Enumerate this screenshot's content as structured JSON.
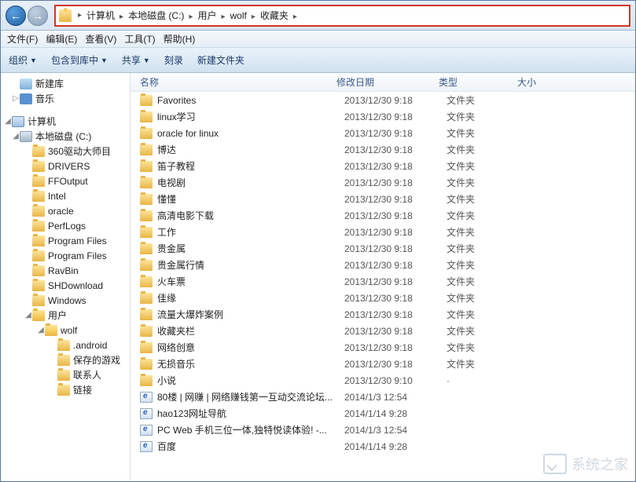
{
  "breadcrumb": [
    "计算机",
    "本地磁盘 (C:)",
    "用户",
    "wolf",
    "收藏夹"
  ],
  "menu": {
    "file": "文件(F)",
    "edit": "编辑(E)",
    "view": "查看(V)",
    "tools": "工具(T)",
    "help": "帮助(H)"
  },
  "toolbar": {
    "organize": "组织",
    "include": "包含到库中",
    "share": "共享",
    "burn": "刻录",
    "newfolder": "新建文件夹"
  },
  "columns": {
    "name": "名称",
    "date": "修改日期",
    "type": "类型",
    "size": "大小"
  },
  "tree": [
    {
      "label": "新建库",
      "indent": 1,
      "icon": "lib",
      "exp": ""
    },
    {
      "label": "音乐",
      "indent": 1,
      "icon": "music",
      "exp": "▷"
    },
    {
      "label": "",
      "indent": 0,
      "icon": "",
      "exp": ""
    },
    {
      "label": "计算机",
      "indent": 0,
      "icon": "computer",
      "exp": "◢"
    },
    {
      "label": "本地磁盘 (C:)",
      "indent": 1,
      "icon": "disk",
      "exp": "◢"
    },
    {
      "label": "360驱动大师目",
      "indent": 2,
      "icon": "folder",
      "exp": ""
    },
    {
      "label": "DRIVERS",
      "indent": 2,
      "icon": "folder",
      "exp": ""
    },
    {
      "label": "FFOutput",
      "indent": 2,
      "icon": "folder",
      "exp": ""
    },
    {
      "label": "Intel",
      "indent": 2,
      "icon": "folder",
      "exp": ""
    },
    {
      "label": "oracle",
      "indent": 2,
      "icon": "folder",
      "exp": ""
    },
    {
      "label": "PerfLogs",
      "indent": 2,
      "icon": "folder",
      "exp": ""
    },
    {
      "label": "Program Files",
      "indent": 2,
      "icon": "folder",
      "exp": ""
    },
    {
      "label": "Program Files",
      "indent": 2,
      "icon": "folder",
      "exp": ""
    },
    {
      "label": "RavBin",
      "indent": 2,
      "icon": "folder",
      "exp": ""
    },
    {
      "label": "SHDownload",
      "indent": 2,
      "icon": "folder",
      "exp": ""
    },
    {
      "label": "Windows",
      "indent": 2,
      "icon": "folder",
      "exp": ""
    },
    {
      "label": "用户",
      "indent": 2,
      "icon": "folder-open",
      "exp": "◢"
    },
    {
      "label": "wolf",
      "indent": 3,
      "icon": "folder-open",
      "exp": "◢"
    },
    {
      "label": ".android",
      "indent": 4,
      "icon": "folder",
      "exp": ""
    },
    {
      "label": "保存的游戏",
      "indent": 4,
      "icon": "folder",
      "exp": ""
    },
    {
      "label": "联系人",
      "indent": 4,
      "icon": "folder",
      "exp": ""
    },
    {
      "label": "链接",
      "indent": 4,
      "icon": "folder",
      "exp": ""
    }
  ],
  "files": [
    {
      "name": "Favorites",
      "date": "2013/12/30 9:18",
      "type": "文件夹",
      "icon": "folder"
    },
    {
      "name": "linux学习",
      "date": "2013/12/30 9:18",
      "type": "文件夹",
      "icon": "folder"
    },
    {
      "name": "oracle for linux",
      "date": "2013/12/30 9:18",
      "type": "文件夹",
      "icon": "folder"
    },
    {
      "name": "博达",
      "date": "2013/12/30 9:18",
      "type": "文件夹",
      "icon": "folder"
    },
    {
      "name": "笛子教程",
      "date": "2013/12/30 9:18",
      "type": "文件夹",
      "icon": "folder"
    },
    {
      "name": "电视剧",
      "date": "2013/12/30 9:18",
      "type": "文件夹",
      "icon": "folder"
    },
    {
      "name": "懂懂",
      "date": "2013/12/30 9:18",
      "type": "文件夹",
      "icon": "folder"
    },
    {
      "name": "高清电影下载",
      "date": "2013/12/30 9:18",
      "type": "文件夹",
      "icon": "folder"
    },
    {
      "name": "工作",
      "date": "2013/12/30 9:18",
      "type": "文件夹",
      "icon": "folder"
    },
    {
      "name": "贵金属",
      "date": "2013/12/30 9:18",
      "type": "文件夹",
      "icon": "folder"
    },
    {
      "name": "贵金属行情",
      "date": "2013/12/30 9:18",
      "type": "文件夹",
      "icon": "folder"
    },
    {
      "name": "火车票",
      "date": "2013/12/30 9:18",
      "type": "文件夹",
      "icon": "folder"
    },
    {
      "name": "佳缘",
      "date": "2013/12/30 9:18",
      "type": "文件夹",
      "icon": "folder"
    },
    {
      "name": "流量大爆炸案例",
      "date": "2013/12/30 9:18",
      "type": "文件夹",
      "icon": "folder"
    },
    {
      "name": "收藏夹栏",
      "date": "2013/12/30 9:18",
      "type": "文件夹",
      "icon": "folder"
    },
    {
      "name": "网络创意",
      "date": "2013/12/30 9:18",
      "type": "文件夹",
      "icon": "folder"
    },
    {
      "name": "无损音乐",
      "date": "2013/12/30 9:18",
      "type": "文件夹",
      "icon": "folder"
    },
    {
      "name": "小说",
      "date": "2013/12/30 9:10",
      "type": "·",
      "icon": "folder"
    },
    {
      "name": "80楼 | 网赚 | 网络赚钱第一互动交流论坛...",
      "date": "2014/1/3 12:54",
      "type": "",
      "icon": "url"
    },
    {
      "name": "hao123网址导航",
      "date": "2014/1/14 9:28",
      "type": "",
      "icon": "url"
    },
    {
      "name": "PC Web 手机三位一体,独特悦读体验! -...",
      "date": "2014/1/3 12:54",
      "type": "",
      "icon": "url"
    },
    {
      "name": "百度",
      "date": "2014/1/14 9:28",
      "type": "",
      "icon": "url"
    }
  ],
  "watermark": "系统之家"
}
